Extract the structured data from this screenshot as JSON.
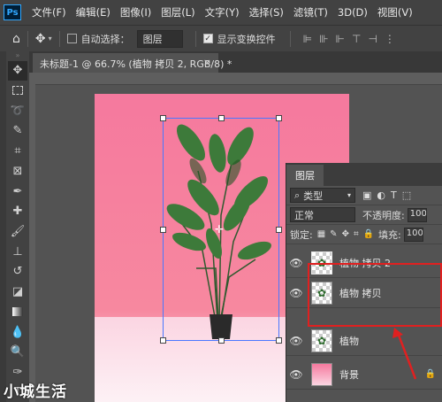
{
  "menubar": {
    "logo": "Ps",
    "items": [
      "文件(F)",
      "编辑(E)",
      "图像(I)",
      "图层(L)",
      "文字(Y)",
      "选择(S)",
      "滤镜(T)",
      "3D(D)",
      "视图(V)"
    ]
  },
  "options": {
    "home_icon": "home-icon",
    "move_icon": "move-icon",
    "auto_select_label": "自动选择：",
    "auto_select_checked": false,
    "auto_select_value": "图层",
    "show_transform_label": "显示变换控件",
    "show_transform_checked": true
  },
  "document": {
    "tab_title": "未标题-1 @ 66.7% (植物 拷贝 2, RGB/8) *",
    "close": "×"
  },
  "tools": [
    "move-icon",
    "marquee-icon",
    "lasso-icon",
    "quick-select-icon",
    "crop-icon",
    "frame-icon",
    "eyedropper-icon",
    "healing-icon",
    "brush-icon",
    "stamp-icon",
    "history-brush-icon",
    "eraser-icon",
    "gradient-icon",
    "blur-icon",
    "dodge-icon",
    "pen-icon",
    "type-icon"
  ],
  "layers_panel": {
    "tab": "图层",
    "filter_kind": "类型",
    "blend_mode": "正常",
    "opacity_label": "不透明度:",
    "opacity_value": "100",
    "lock_label": "锁定:",
    "fill_label": "填充:",
    "fill_value": "100",
    "layers": [
      {
        "name": "植物 拷贝 2",
        "visible": true,
        "selected": true
      },
      {
        "name": "植物 拷贝",
        "visible": true,
        "selected": false
      },
      {
        "name": "植物",
        "visible": true,
        "selected": false
      },
      {
        "name": "背景",
        "visible": true,
        "selected": false
      }
    ]
  },
  "watermark": "小城生活",
  "colors": {
    "canvas_pink": "#f5799e",
    "highlight": "#e02020",
    "transform_box": "#4a78ff"
  }
}
